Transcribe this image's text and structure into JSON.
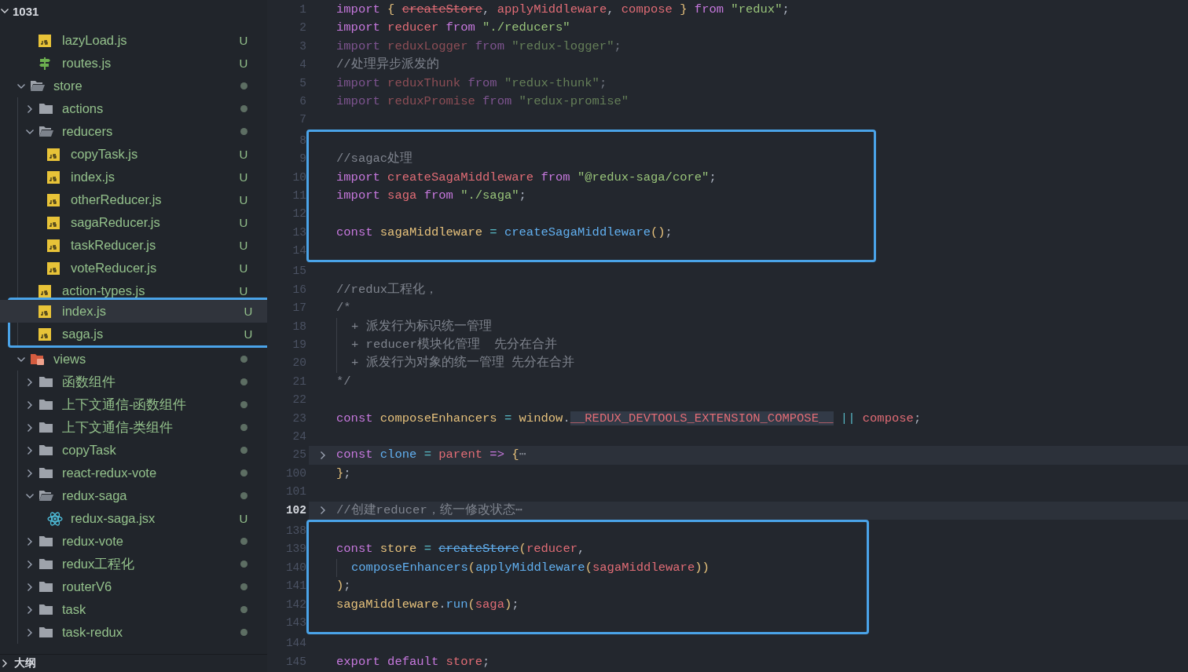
{
  "sidebar": {
    "root": {
      "label": "1031",
      "expanded": true
    },
    "tree": [
      {
        "kind": "group",
        "children": [
          {
            "kind": "js-file",
            "name": "lazyLoad.js",
            "badge": "U",
            "selected": false,
            "boxed": false
          },
          {
            "kind": "route-file",
            "name": "routes.js",
            "badge": "U",
            "selected": false,
            "boxed": false
          }
        ]
      },
      {
        "kind": "folder",
        "name": "store",
        "expanded": true,
        "changed": true,
        "selected": false,
        "boxed": false,
        "children": [
          {
            "kind": "folder",
            "name": "actions",
            "expanded": false,
            "changed": true,
            "selected": false,
            "boxed": false
          },
          {
            "kind": "folder",
            "name": "reducers",
            "expanded": true,
            "changed": true,
            "selected": false,
            "boxed": false,
            "children": [
              {
                "kind": "js-file",
                "name": "copyTask.js",
                "badge": "U",
                "selected": false,
                "boxed": false
              },
              {
                "kind": "js-file",
                "name": "index.js",
                "badge": "U",
                "selected": false,
                "boxed": false
              },
              {
                "kind": "js-file",
                "name": "otherReducer.js",
                "badge": "U",
                "selected": false,
                "boxed": false
              },
              {
                "kind": "js-file",
                "name": "sagaReducer.js",
                "badge": "U",
                "selected": false,
                "boxed": false
              },
              {
                "kind": "js-file",
                "name": "taskReducer.js",
                "badge": "U",
                "selected": false,
                "boxed": false
              },
              {
                "kind": "js-file",
                "name": "voteReducer.js",
                "badge": "U",
                "selected": false,
                "boxed": false
              }
            ]
          },
          {
            "kind": "js-file",
            "name": "action-types.js",
            "badge": "U",
            "selected": false,
            "boxed": false
          },
          {
            "kind": "js-file",
            "name": "index.js",
            "badge": "U",
            "selected": true,
            "boxed": true
          },
          {
            "kind": "js-file",
            "name": "saga.js",
            "badge": "U",
            "selected": false,
            "boxed": true
          }
        ]
      },
      {
        "kind": "views-folder",
        "name": "views",
        "expanded": true,
        "changed": true,
        "selected": false,
        "boxed": false,
        "children": [
          {
            "kind": "folder",
            "name": "函数组件",
            "expanded": false,
            "changed": true,
            "selected": false,
            "boxed": false
          },
          {
            "kind": "folder",
            "name": "上下文通信-函数组件",
            "expanded": false,
            "changed": true,
            "selected": false,
            "boxed": false
          },
          {
            "kind": "folder",
            "name": "上下文通信-类组件",
            "expanded": false,
            "changed": true,
            "selected": false,
            "boxed": false
          },
          {
            "kind": "folder",
            "name": "copyTask",
            "expanded": false,
            "changed": true,
            "selected": false,
            "boxed": false
          },
          {
            "kind": "folder",
            "name": "react-redux-vote",
            "expanded": false,
            "changed": true,
            "selected": false,
            "boxed": false
          },
          {
            "kind": "folder",
            "name": "redux-saga",
            "expanded": true,
            "changed": true,
            "selected": false,
            "boxed": false,
            "children": [
              {
                "kind": "react-file",
                "name": "redux-saga.jsx",
                "badge": "U",
                "selected": false,
                "boxed": false
              }
            ]
          },
          {
            "kind": "folder",
            "name": "redux-vote",
            "expanded": false,
            "changed": true,
            "selected": false,
            "boxed": false
          },
          {
            "kind": "folder",
            "name": "redux工程化",
            "expanded": false,
            "changed": true,
            "selected": false,
            "boxed": false
          },
          {
            "kind": "folder",
            "name": "routerV6",
            "expanded": false,
            "changed": true,
            "selected": false,
            "boxed": false
          },
          {
            "kind": "folder",
            "name": "task",
            "expanded": false,
            "changed": true,
            "selected": false,
            "boxed": false
          },
          {
            "kind": "folder",
            "name": "task-redux",
            "expanded": false,
            "changed": true,
            "selected": false,
            "boxed": false
          }
        ]
      }
    ],
    "outline": {
      "label": "大纲",
      "expanded": false
    }
  },
  "editor": {
    "blocks": [
      {
        "boxed": false,
        "lines": [
          {
            "number": "1",
            "tokens": [
              {
                "kind": "keyword",
                "text": "import"
              },
              {
                "kind": "bracket",
                "text": " { "
              },
              {
                "kind": "variable",
                "text": "createStore",
                "strike": true
              },
              {
                "kind": "plain",
                "text": ","
              },
              {
                "kind": "variable",
                "text": " applyMiddleware"
              },
              {
                "kind": "plain",
                "text": ","
              },
              {
                "kind": "variable",
                "text": " compose"
              },
              {
                "kind": "bracket",
                "text": " }"
              },
              {
                "kind": "keyword",
                "text": " from"
              },
              {
                "kind": "string",
                "text": " \"redux\""
              },
              {
                "kind": "plain",
                "text": ";"
              }
            ]
          },
          {
            "number": "2",
            "tokens": [
              {
                "kind": "keyword",
                "text": "import"
              },
              {
                "kind": "variable",
                "text": " reducer"
              },
              {
                "kind": "keyword",
                "text": " from"
              },
              {
                "kind": "string",
                "text": " \"./reducers\""
              }
            ]
          },
          {
            "number": "3",
            "faded": true,
            "tokens": [
              {
                "kind": "keyword",
                "text": "import"
              },
              {
                "kind": "variable",
                "text": " reduxLogger"
              },
              {
                "kind": "keyword",
                "text": " from"
              },
              {
                "kind": "string",
                "text": " \"redux-logger\""
              },
              {
                "kind": "plain",
                "text": ";"
              }
            ]
          },
          {
            "number": "4",
            "tokens": [
              {
                "kind": "comment",
                "text": "//处理异步派发的"
              }
            ]
          },
          {
            "number": "5",
            "faded": true,
            "tokens": [
              {
                "kind": "keyword",
                "text": "import"
              },
              {
                "kind": "variable",
                "text": " reduxThunk"
              },
              {
                "kind": "keyword",
                "text": " from"
              },
              {
                "kind": "string",
                "text": " \"redux-thunk\""
              },
              {
                "kind": "plain",
                "text": ";"
              }
            ]
          },
          {
            "number": "6",
            "faded": true,
            "tokens": [
              {
                "kind": "keyword",
                "text": "import"
              },
              {
                "kind": "variable",
                "text": " reduxPromise"
              },
              {
                "kind": "keyword",
                "text": " from"
              },
              {
                "kind": "string",
                "text": " \"redux-promise\""
              }
            ]
          },
          {
            "number": "7"
          }
        ]
      },
      {
        "boxed": true,
        "lines": [
          {
            "number": "8"
          },
          {
            "number": "9",
            "tokens": [
              {
                "kind": "comment",
                "text": "//sagac处理"
              }
            ]
          },
          {
            "number": "10",
            "tokens": [
              {
                "kind": "keyword",
                "text": "import"
              },
              {
                "kind": "variable",
                "text": " createSagaMiddleware"
              },
              {
                "kind": "keyword",
                "text": " from"
              },
              {
                "kind": "string",
                "text": " \"@redux-saga/core\""
              },
              {
                "kind": "plain",
                "text": ";"
              }
            ]
          },
          {
            "number": "11",
            "tokens": [
              {
                "kind": "keyword",
                "text": "import"
              },
              {
                "kind": "variable",
                "text": " saga"
              },
              {
                "kind": "keyword",
                "text": " from"
              },
              {
                "kind": "string",
                "text": " \"./saga\""
              },
              {
                "kind": "plain",
                "text": ";"
              }
            ]
          },
          {
            "number": "12"
          },
          {
            "number": "13",
            "tokens": [
              {
                "kind": "keyword",
                "text": "const"
              },
              {
                "kind": "constant",
                "text": " sagaMiddleware"
              },
              {
                "kind": "operator",
                "text": " ="
              },
              {
                "kind": "function",
                "text": " createSagaMiddleware"
              },
              {
                "kind": "bracket",
                "text": "()"
              },
              {
                "kind": "plain",
                "text": ";"
              }
            ]
          },
          {
            "number": "14"
          }
        ]
      },
      {
        "boxed": false,
        "lines": [
          {
            "number": "15"
          },
          {
            "number": "16",
            "tokens": [
              {
                "kind": "comment",
                "text": "//redux工程化，"
              }
            ]
          },
          {
            "number": "17",
            "tokens": [
              {
                "kind": "comment",
                "text": "/*"
              }
            ]
          },
          {
            "number": "18",
            "indented": true,
            "tokens": [
              {
                "kind": "comment",
                "text": "+ 派发行为标识统一管理"
              }
            ]
          },
          {
            "number": "19",
            "indented": true,
            "tokens": [
              {
                "kind": "comment",
                "text": "+ reducer模块化管理  先分在合并"
              }
            ]
          },
          {
            "number": "20",
            "indented": true,
            "tokens": [
              {
                "kind": "comment",
                "text": "+ 派发行为对象的统一管理 先分在合并"
              }
            ]
          },
          {
            "number": "21",
            "tokens": [
              {
                "kind": "comment",
                "text": "*/"
              }
            ]
          },
          {
            "number": "22"
          },
          {
            "number": "23",
            "tokens": [
              {
                "kind": "keyword",
                "text": "const"
              },
              {
                "kind": "constant",
                "text": " composeEnhancers"
              },
              {
                "kind": "operator",
                "text": " ="
              },
              {
                "kind": "constant",
                "text": " window"
              },
              {
                "kind": "plain",
                "text": "."
              },
              {
                "kind": "variable",
                "text": "__REDUX_DEVTOOLS_EXTENSION_COMPOSE__",
                "highlight": true
              },
              {
                "kind": "operator",
                "text": " ||"
              },
              {
                "kind": "variable",
                "text": " compose"
              },
              {
                "kind": "plain",
                "text": ";"
              }
            ]
          },
          {
            "number": "24"
          },
          {
            "number": "25",
            "folded": true,
            "highlighted": true,
            "tokens": [
              {
                "kind": "keyword",
                "text": "const"
              },
              {
                "kind": "function",
                "text": " clone"
              },
              {
                "kind": "operator",
                "text": " ="
              },
              {
                "kind": "variable",
                "text": " parent"
              },
              {
                "kind": "keyword",
                "text": " =>"
              },
              {
                "kind": "bracket",
                "text": " {"
              },
              {
                "kind": "comment",
                "text": "⋯"
              }
            ]
          },
          {
            "number": "100",
            "tokens": [
              {
                "kind": "bracket",
                "text": "}"
              },
              {
                "kind": "plain",
                "text": ";"
              }
            ]
          },
          {
            "number": "101"
          },
          {
            "number": "102",
            "folded": true,
            "highlighted": true,
            "current": true,
            "tokens": [
              {
                "kind": "comment",
                "text": "//创建reducer，统一修改状态"
              },
              {
                "kind": "comment",
                "text": "⋯"
              }
            ]
          }
        ]
      },
      {
        "boxed": true,
        "lines": [
          {
            "number": "138"
          },
          {
            "number": "139",
            "tokens": [
              {
                "kind": "keyword",
                "text": "const"
              },
              {
                "kind": "constant",
                "text": " store"
              },
              {
                "kind": "operator",
                "text": " = "
              },
              {
                "kind": "function",
                "text": "createStore",
                "strike": true
              },
              {
                "kind": "bracket",
                "text": "("
              },
              {
                "kind": "variable",
                "text": "reducer"
              },
              {
                "kind": "plain",
                "text": ","
              }
            ]
          },
          {
            "number": "140",
            "indented": true,
            "tokens": [
              {
                "kind": "function",
                "text": "composeEnhancers"
              },
              {
                "kind": "bracket",
                "text": "("
              },
              {
                "kind": "function",
                "text": "applyMiddleware"
              },
              {
                "kind": "bracket",
                "text": "("
              },
              {
                "kind": "variable",
                "text": "sagaMiddleware"
              },
              {
                "kind": "bracket",
                "text": "))"
              }
            ]
          },
          {
            "number": "141",
            "tokens": [
              {
                "kind": "bracket",
                "text": ")"
              },
              {
                "kind": "plain",
                "text": ";"
              }
            ]
          },
          {
            "number": "142",
            "tokens": [
              {
                "kind": "constant",
                "text": "sagaMiddleware"
              },
              {
                "kind": "plain",
                "text": "."
              },
              {
                "kind": "function",
                "text": "run"
              },
              {
                "kind": "bracket",
                "text": "("
              },
              {
                "kind": "variable",
                "text": "saga"
              },
              {
                "kind": "bracket",
                "text": ")"
              },
              {
                "kind": "plain",
                "text": ";"
              }
            ]
          },
          {
            "number": "143"
          }
        ]
      },
      {
        "boxed": false,
        "lines": [
          {
            "number": "144"
          },
          {
            "number": "145",
            "tokens": [
              {
                "kind": "keyword",
                "text": "export"
              },
              {
                "kind": "keyword",
                "text": " default"
              },
              {
                "kind": "variable",
                "text": " store"
              },
              {
                "kind": "plain",
                "text": ";"
              }
            ]
          }
        ]
      }
    ]
  }
}
